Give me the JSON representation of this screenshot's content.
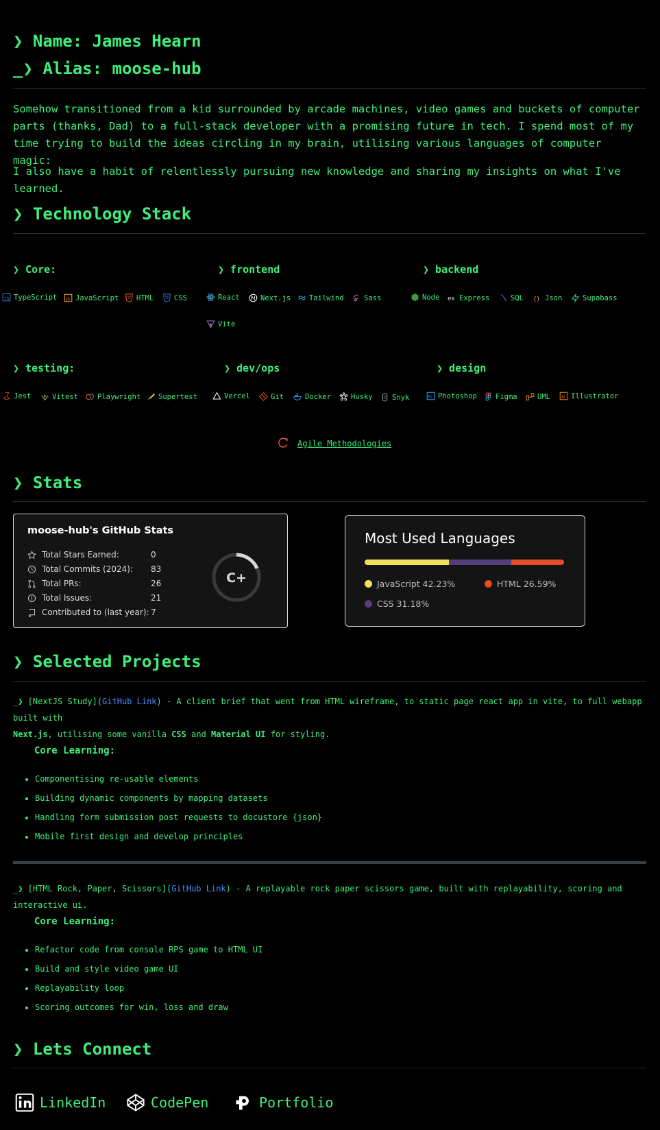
{
  "header": {
    "name_line": "❯ Name: James Hearn",
    "alias_line": "_❯ Alias: moose-hub"
  },
  "bio": {
    "p1": "Somehow transitioned from a kid surrounded by arcade machines, video games and buckets of computer parts (thanks, Dad) to a full-stack developer with a promising future in tech. I spend most of my time trying to build the ideas circling in my brain, utilising various languages of computer magic:",
    "p2": "I also have a habit of relentlessly pursuing new knowledge and sharing my insights on what I've learned."
  },
  "tech": {
    "title": "❯ Technology Stack",
    "categories": {
      "core": "❯ Core:",
      "frontend": "❯ frontend",
      "backend": "❯ backend",
      "testing": "❯ testing:",
      "devops": "❯ dev/ops",
      "design": "❯ design"
    },
    "chips": [
      {
        "label": "TypeScript",
        "icon": "typescript-icon",
        "color": "#3178c6"
      },
      {
        "label": "JavaScript",
        "icon": "javascript-icon",
        "color": "#f7a21b"
      },
      {
        "label": "HTML",
        "icon": "html5-icon",
        "color": "#e5532d"
      },
      {
        "label": "CSS",
        "icon": "css3-icon",
        "color": "#2f6fe0"
      },
      {
        "label": "React",
        "icon": "react-icon",
        "color": "#4aa8e8"
      },
      {
        "label": "Next.js",
        "icon": "nextjs-icon",
        "color": "#ffffff"
      },
      {
        "label": "Tailwind",
        "icon": "tailwind-icon",
        "color": "#38bdf8"
      },
      {
        "label": "Sass",
        "icon": "sass-icon",
        "color": "#cd6799"
      },
      {
        "label": "Vite",
        "icon": "vite-icon",
        "color": "#9a6cf0"
      },
      {
        "label": "Node",
        "icon": "node-icon",
        "color": "#3c9a3a"
      },
      {
        "label": "Express",
        "icon": "express-icon",
        "color": "#dddddd"
      },
      {
        "label": "SQL",
        "icon": "sql-icon",
        "color": "#2d6fb4"
      },
      {
        "label": "Json",
        "icon": "json-icon",
        "color": "#f5a623"
      },
      {
        "label": "Supabass",
        "icon": "supabase-icon",
        "color": "#3ecf8e"
      },
      {
        "label": "Jest",
        "icon": "jest-icon",
        "color": "#c63d14"
      },
      {
        "label": "Vitest",
        "icon": "vitest-icon",
        "color": "#fcc72b"
      },
      {
        "label": "Playwright",
        "icon": "playwright-icon",
        "color": "#e2574c"
      },
      {
        "label": "Supertest",
        "icon": "supertest-icon",
        "color": "#f0c330"
      },
      {
        "label": "Vercel",
        "icon": "vercel-icon",
        "color": "#ffffff"
      },
      {
        "label": "Git",
        "icon": "git-icon",
        "color": "#f05032"
      },
      {
        "label": "Docker",
        "icon": "docker-icon",
        "color": "#2496ed"
      },
      {
        "label": "Husky",
        "icon": "husky-icon",
        "color": "#ffffff"
      },
      {
        "label": "Snyk",
        "icon": "snyk-icon",
        "color": "#aaaaaa"
      },
      {
        "label": "Photoshop",
        "icon": "photoshop-icon",
        "color": "#31a8ff"
      },
      {
        "label": "Figma",
        "icon": "figma-icon",
        "color": "#f24e1e"
      },
      {
        "label": "UML",
        "icon": "uml-icon",
        "color": "#f28c28"
      },
      {
        "label": "Illustrator",
        "icon": "illustrator-icon",
        "color": "#ff7c00"
      }
    ],
    "agile": "Agile Methodologies"
  },
  "stats": {
    "title": "❯ Stats",
    "card_title": "moose-hub's GitHub Stats",
    "rows": [
      {
        "label": "Total Stars Earned:",
        "value": "0"
      },
      {
        "label": "Total Commits (2024):",
        "value": "83"
      },
      {
        "label": "Total PRs:",
        "value": "26"
      },
      {
        "label": "Total Issues:",
        "value": "21"
      },
      {
        "label": "Contributed to (last year):",
        "value": "7"
      }
    ],
    "grade": "C+",
    "langs_title": "Most Used Languages",
    "langs": [
      {
        "name": "JavaScript",
        "pct": 42.23,
        "label": "JavaScript 42.23%",
        "color": "#f1e05a"
      },
      {
        "name": "CSS",
        "pct": 31.18,
        "label": "CSS 31.18%",
        "color": "#563d7c"
      },
      {
        "name": "HTML",
        "pct": 26.59,
        "label": "HTML 26.59%",
        "color": "#e34c26"
      }
    ]
  },
  "projects": {
    "title": "❯ Selected Projects",
    "p1": {
      "prefix": "_❯ [NextJS Study](",
      "link": "GitHub Link",
      "desc1": ") - A client brief that went from HTML wireframe, to static page react app in vite, to full webapp built with",
      "next": "Next.js",
      "desc2": ", utilising some vanilla ",
      "css": "CSS",
      "and": " and ",
      "mui": "Material UI",
      "desc3": " for styling.",
      "core": "Core Learning:",
      "items": [
        "Componentising re-usable elements",
        "Building dynamic components by mapping datasets",
        "Handling form submission post requests to docustore {json}",
        "Mobile first design and develop principles"
      ]
    },
    "p2": {
      "prefix": "_❯ [HTML Rock, Paper, Scissors](",
      "link": "GitHub Link",
      "desc": ") - A replayable rock paper scissors game, built with replayability, scoring and interactive ui.",
      "core": "Core Learning:",
      "items": [
        "Refactor code from console RPS game to HTML UI",
        "Build and style video game UI",
        "Replayability loop",
        "Scoring outcomes for win, loss and draw"
      ]
    }
  },
  "connect": {
    "title": "❯ Lets Connect",
    "links": [
      {
        "label": "LinkedIn",
        "icon": "linkedin-icon"
      },
      {
        "label": "CodePen",
        "icon": "codepen-icon"
      },
      {
        "label": "Portfolio",
        "icon": "portfolio-icon"
      }
    ]
  }
}
